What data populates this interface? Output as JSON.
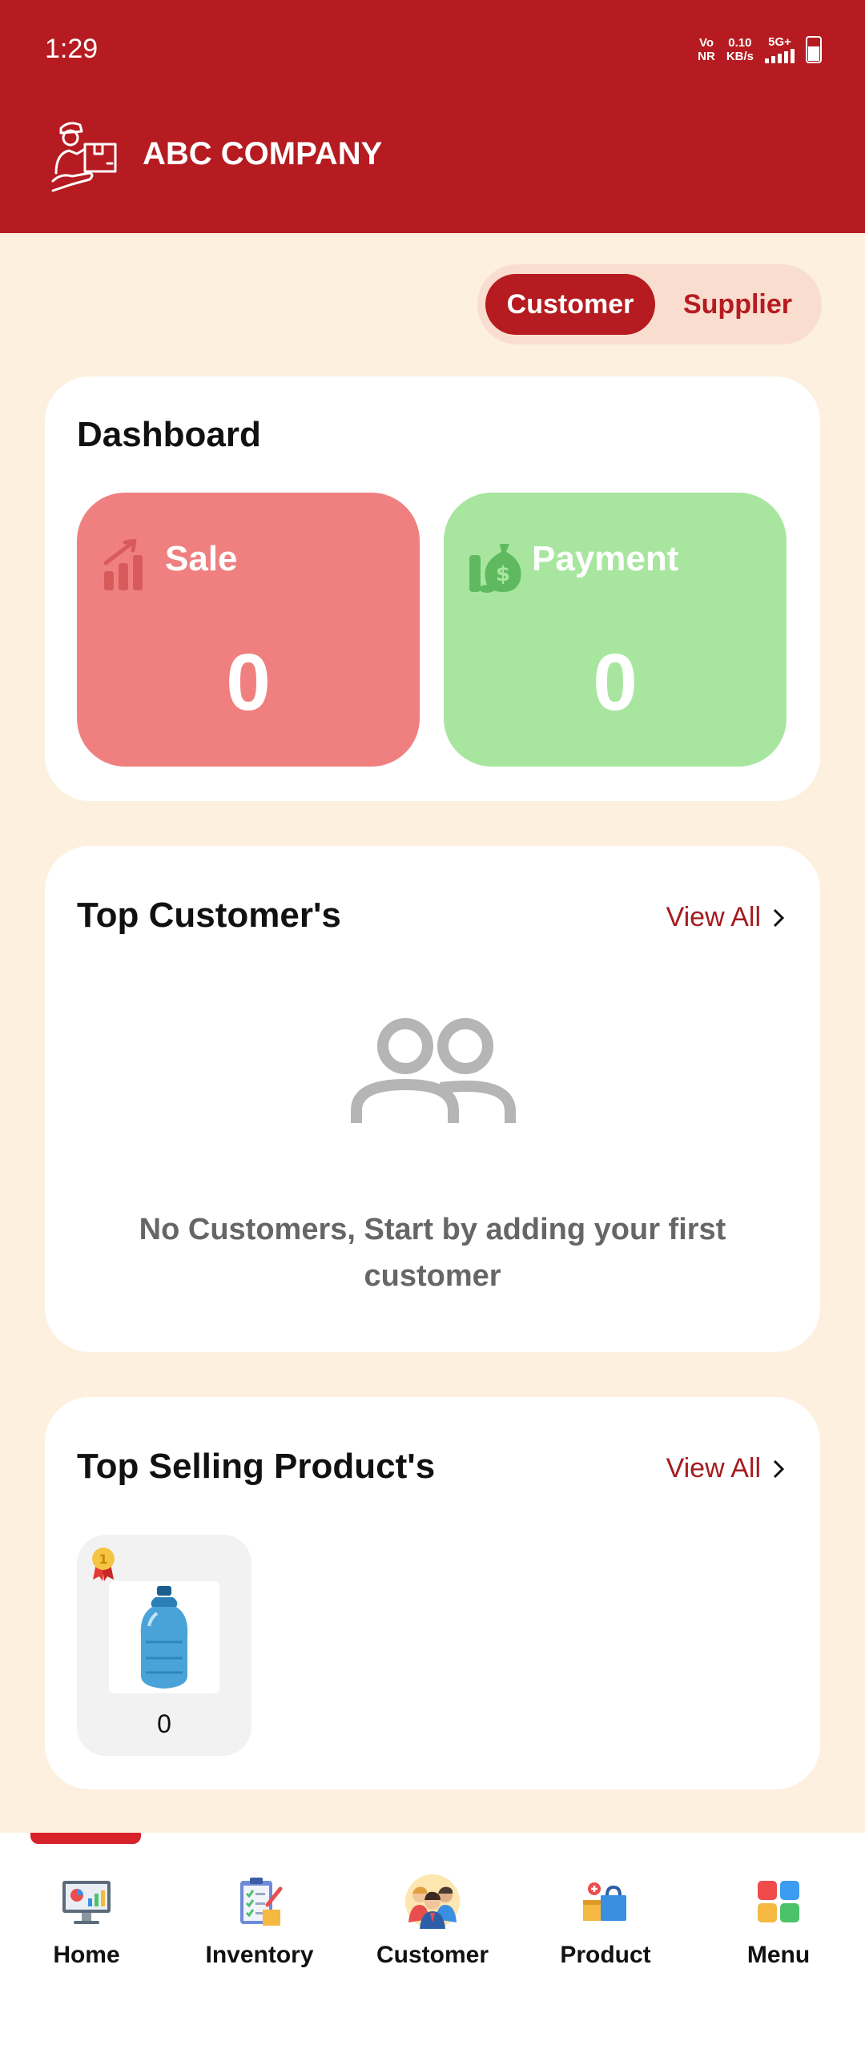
{
  "status_bar": {
    "time": "1:29",
    "volte": "Vo",
    "volte_sub": "NR",
    "speed": "0.10",
    "speed_unit": "KB/s",
    "network": "5G+"
  },
  "header": {
    "company_name": "ABC COMPANY",
    "logo_icon": "delivery-person-icon"
  },
  "toggle": {
    "active": "Customer",
    "inactive": "Supplier"
  },
  "dashboard": {
    "title": "Dashboard",
    "sale": {
      "label": "Sale",
      "value": "0",
      "color": "#f08080",
      "icon": "bar-chart-up-icon"
    },
    "payment": {
      "label": "Payment",
      "value": "0",
      "color": "#a8e6a0",
      "icon": "money-bag-icon"
    }
  },
  "top_customers": {
    "title": "Top Customer's",
    "view_all": "View All",
    "empty_message": "No Customers, Start by adding your first customer"
  },
  "top_products": {
    "title": "Top Selling Product's",
    "view_all": "View All",
    "items": [
      {
        "count": "0",
        "image": "water-bottle",
        "badge": "1"
      }
    ]
  },
  "bottom_nav": [
    {
      "label": "Home",
      "icon": "dashboard-monitor-icon",
      "active": true
    },
    {
      "label": "Inventory",
      "icon": "clipboard-checklist-icon",
      "active": false
    },
    {
      "label": "Customer",
      "icon": "customers-group-icon",
      "active": false
    },
    {
      "label": "Product",
      "icon": "product-boxes-icon",
      "active": false
    },
    {
      "label": "Menu",
      "icon": "grid-menu-icon",
      "active": false
    }
  ],
  "colors": {
    "brand": "#b51b20",
    "background": "#fdf0de",
    "accent_text": "#a51b1f"
  }
}
